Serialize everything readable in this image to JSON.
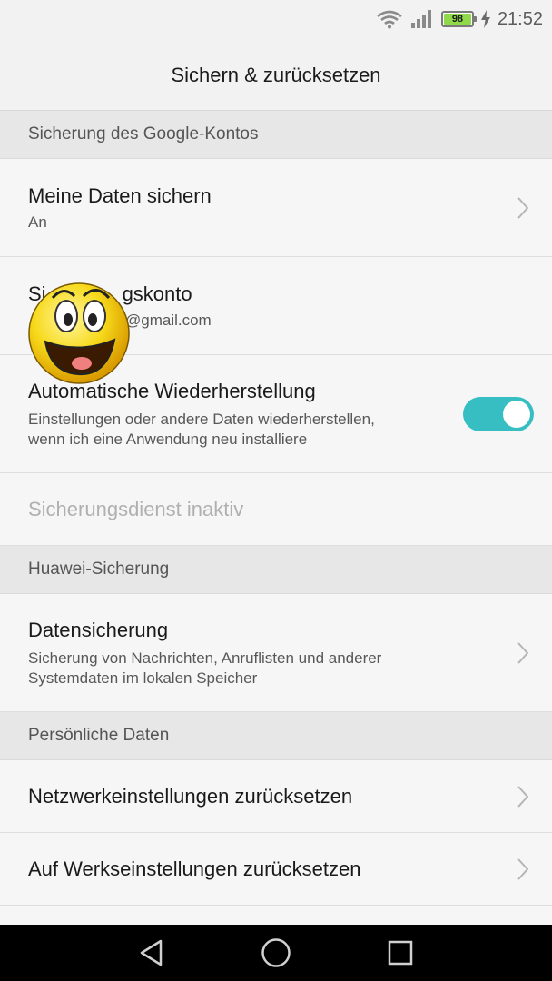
{
  "status_bar": {
    "battery_level": "98",
    "time": "21:52",
    "icons": [
      "wifi-icon",
      "signal-icon",
      "battery-icon",
      "charging-icon"
    ]
  },
  "title": "Sichern & zurücksetzen",
  "sections": {
    "google": {
      "header": "Sicherung des Google-Kontos",
      "backup": {
        "title": "Meine Daten sichern",
        "subtitle": "An"
      },
      "account": {
        "title_left": "Si",
        "title_right": "gskonto",
        "subtitle": "@gmail.com"
      },
      "restore": {
        "title": "Automatische Wiederherstellung",
        "subtitle_line1": "Einstellungen oder andere Daten wiederherstellen,",
        "subtitle_line2": "wenn ich eine Anwendung neu installiere",
        "enabled": true
      },
      "inactive": {
        "title": "Sicherungsdienst inaktiv"
      }
    },
    "huawei": {
      "header": "Huawei-Sicherung",
      "data_backup": {
        "title": "Datensicherung",
        "subtitle_line1": "Sicherung von Nachrichten, Anruflisten und anderer",
        "subtitle_line2": "Systemdaten im lokalen Speicher"
      }
    },
    "personal": {
      "header": "Persönliche Daten",
      "network_reset": {
        "title": "Netzwerkeinstellungen zurücksetzen"
      },
      "factory_reset": {
        "title": "Auf Werkseinstellungen zurücksetzen"
      }
    }
  },
  "navbar": {
    "icons": [
      "back-icon",
      "home-icon",
      "recents-icon"
    ]
  },
  "colors": {
    "accent": "#36bec3",
    "battery": "#8fd94a",
    "header_bg": "#e7e7e7"
  }
}
